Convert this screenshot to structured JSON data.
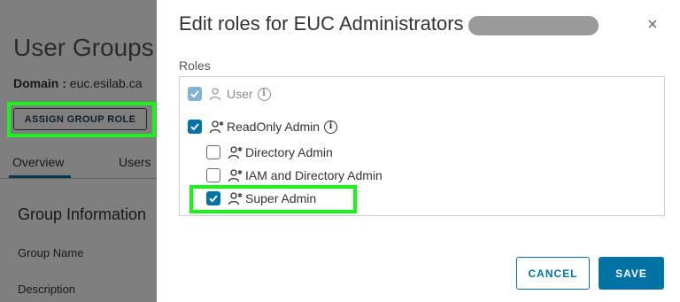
{
  "background": {
    "title": "User Groups",
    "domain_label": "Domain :",
    "domain_value": "euc.esilab.ca",
    "assign_button": "ASSIGN GROUP ROLE",
    "tabs": [
      "Overview",
      "Users"
    ],
    "section_title": "Group Information",
    "labels": [
      "Group Name",
      "Description"
    ]
  },
  "modal": {
    "title": "Edit roles for EUC Administrators",
    "close_glyph": "×",
    "roles_heading": "Roles",
    "roles": [
      {
        "label": "User",
        "checked": true,
        "disabled": true,
        "has_info": true
      },
      {
        "label": "ReadOnly Admin",
        "checked": true,
        "disabled": false,
        "has_info": true
      },
      {
        "label": "Directory Admin",
        "checked": false,
        "disabled": false,
        "has_info": false
      },
      {
        "label": "IAM and Directory Admin",
        "checked": false,
        "disabled": false,
        "has_info": false
      },
      {
        "label": "Super Admin",
        "checked": true,
        "disabled": false,
        "has_info": false
      }
    ],
    "info_glyph": "i",
    "cancel_label": "CANCEL",
    "save_label": "SAVE"
  },
  "colors": {
    "accent": "#0072a3",
    "highlight": "#16f516"
  }
}
